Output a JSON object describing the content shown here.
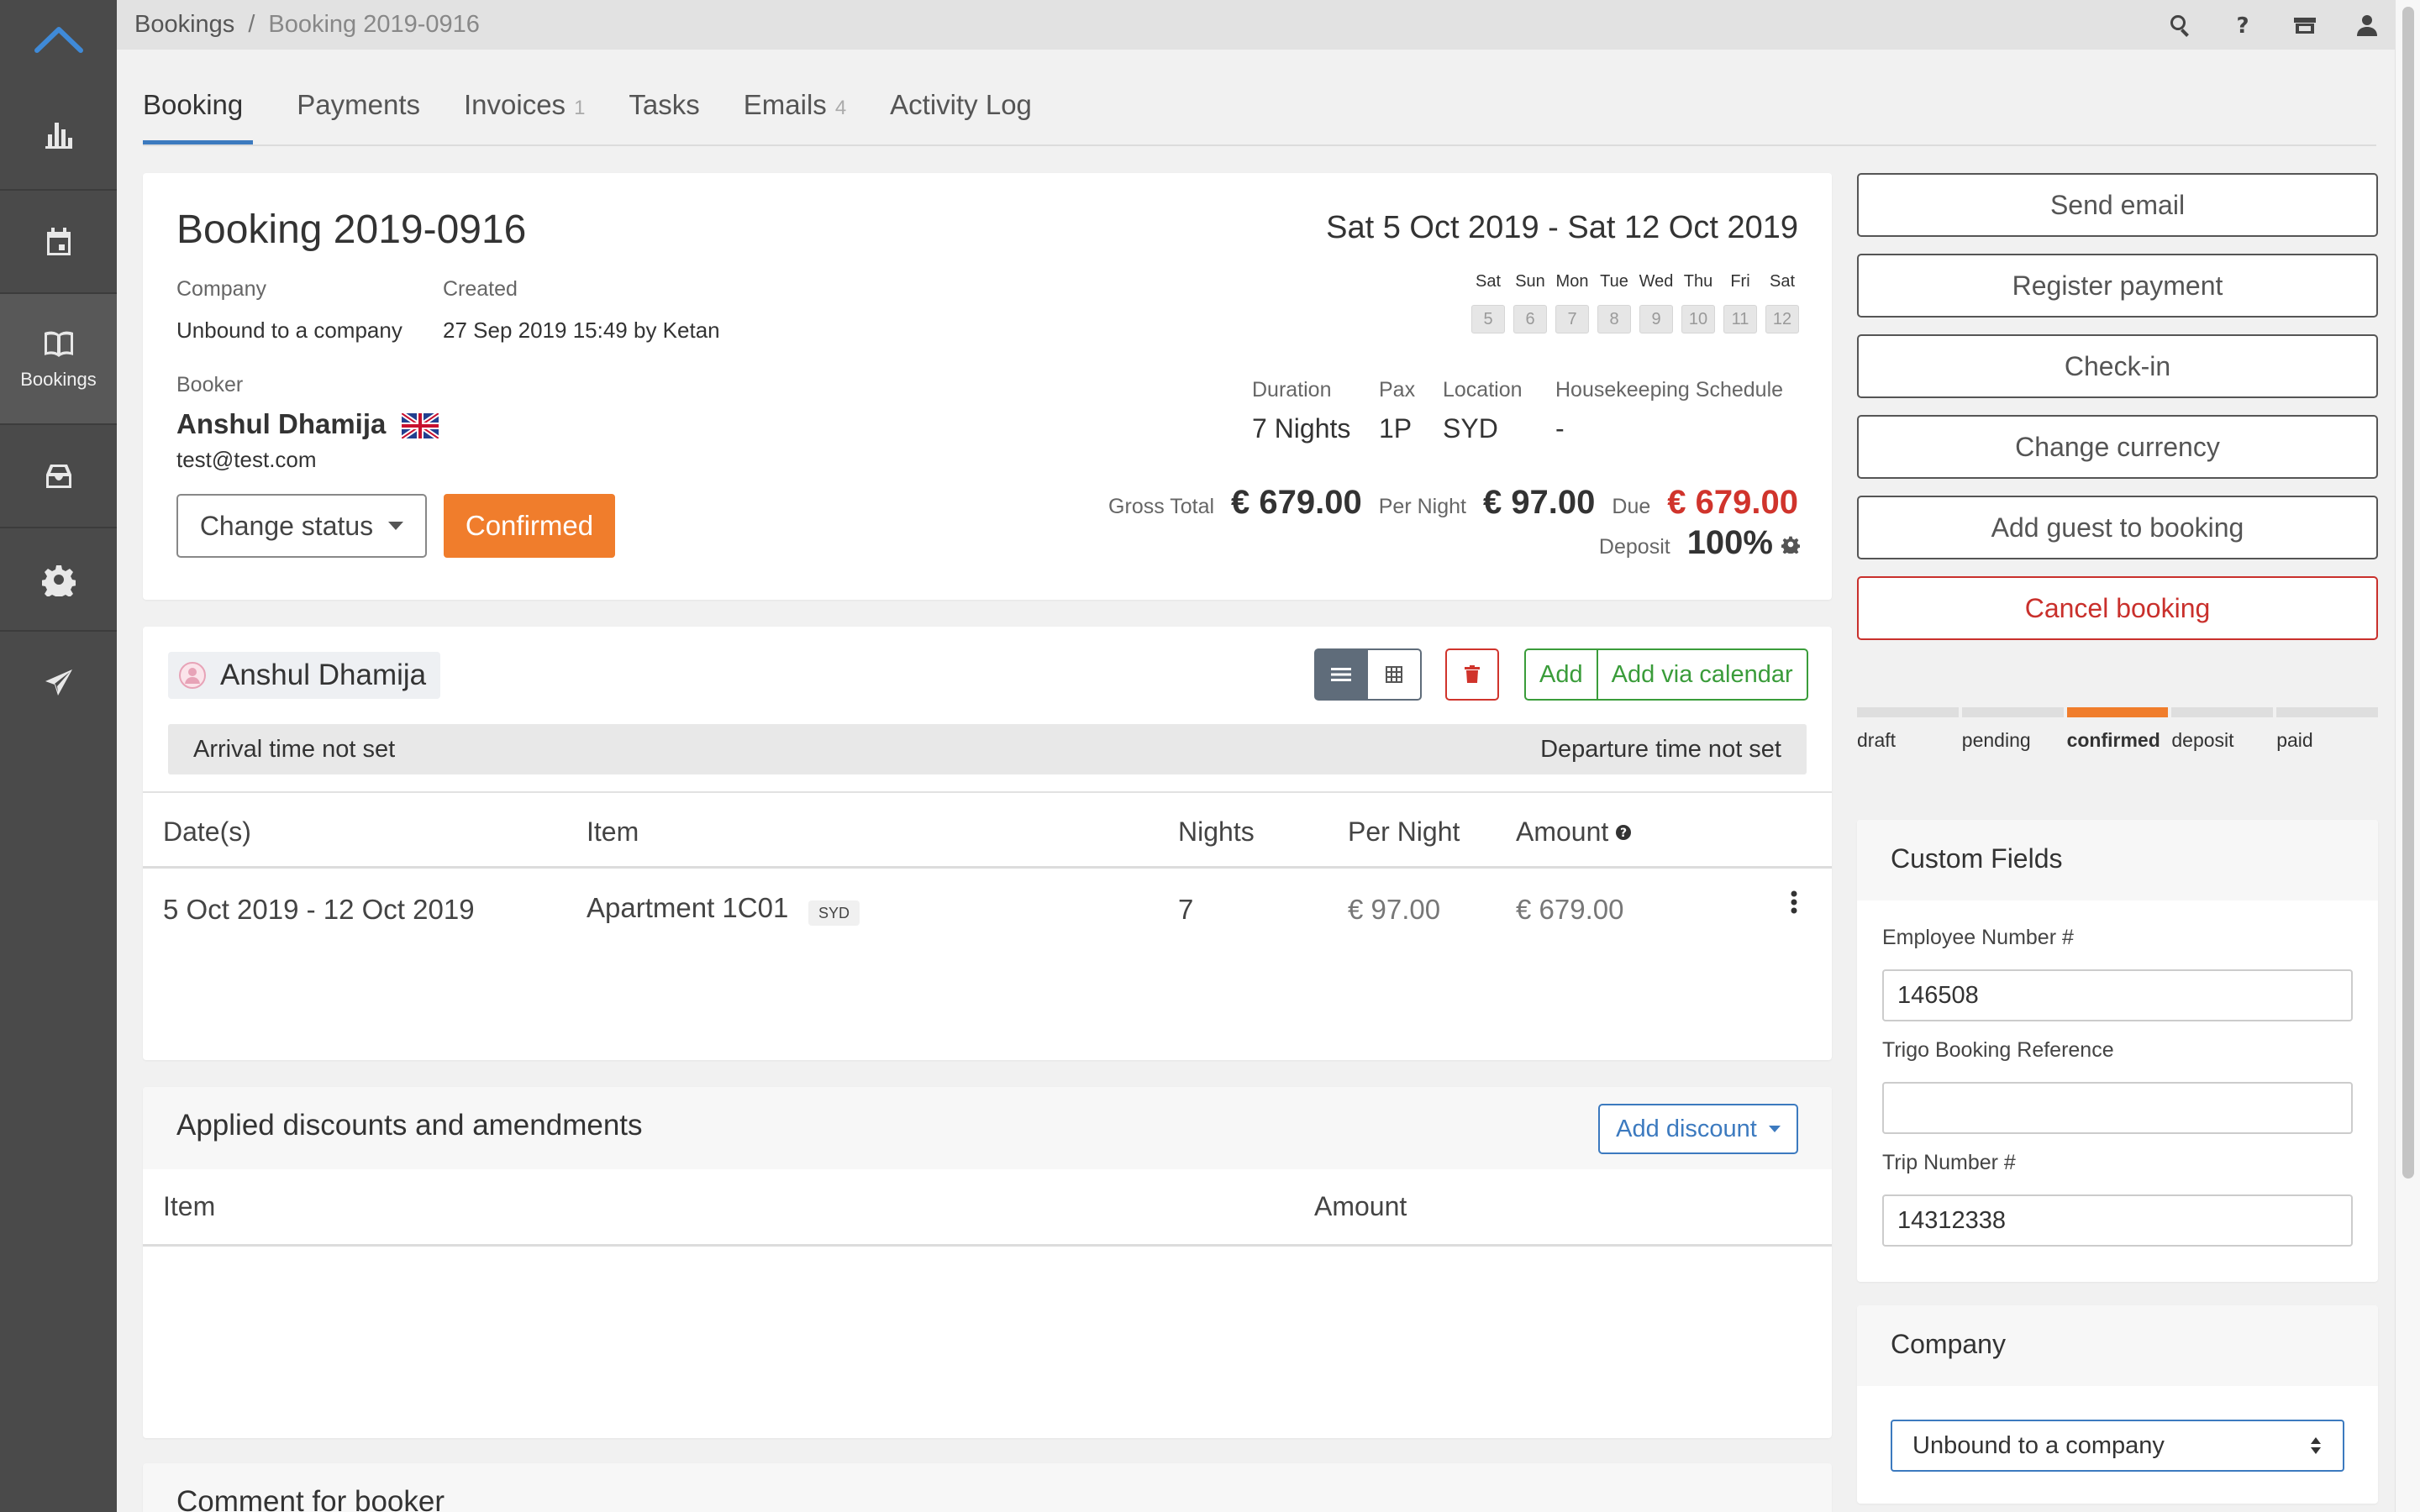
{
  "sidebar": {
    "items": [
      {
        "icon": "chart-icon",
        "label": ""
      },
      {
        "icon": "calendar-icon",
        "label": ""
      },
      {
        "icon": "book-icon",
        "label": "Bookings"
      },
      {
        "icon": "inbox-icon",
        "label": ""
      },
      {
        "icon": "gear-icon",
        "label": ""
      },
      {
        "icon": "send-icon",
        "label": ""
      }
    ]
  },
  "breadcrumb": {
    "root": "Bookings",
    "separator": "/",
    "current": "Booking 2019-0916"
  },
  "tabs": [
    {
      "label": "Booking",
      "count": ""
    },
    {
      "label": "Payments",
      "count": ""
    },
    {
      "label": "Invoices",
      "count": "1"
    },
    {
      "label": "Tasks",
      "count": ""
    },
    {
      "label": "Emails",
      "count": "4"
    },
    {
      "label": "Activity Log",
      "count": ""
    }
  ],
  "booking": {
    "title": "Booking 2019-0916",
    "date_range": "Sat 5 Oct 2019 - Sat 12 Oct 2019",
    "company_label": "Company",
    "company_value": "Unbound to a company",
    "created_label": "Created",
    "created_value": "27 Sep 2019 15:49 by Ketan",
    "booker_label": "Booker",
    "booker_name": "Anshul Dhamija",
    "booker_email": "test@test.com",
    "change_status": "Change status",
    "status": "Confirmed",
    "days": [
      {
        "dow": "Sat",
        "day": "5"
      },
      {
        "dow": "Sun",
        "day": "6"
      },
      {
        "dow": "Mon",
        "day": "7"
      },
      {
        "dow": "Tue",
        "day": "8"
      },
      {
        "dow": "Wed",
        "day": "9"
      },
      {
        "dow": "Thu",
        "day": "10"
      },
      {
        "dow": "Fri",
        "day": "11"
      },
      {
        "dow": "Sat",
        "day": "12"
      }
    ],
    "duration_label": "Duration",
    "duration_value": "7 Nights",
    "pax_label": "Pax",
    "pax_value": "1P",
    "location_label": "Location",
    "location_value": "SYD",
    "housekeeping_label": "Housekeeping Schedule",
    "housekeeping_value": "-",
    "gross_label": "Gross Total",
    "gross_value": "€ 679.00",
    "per_night_label": "Per Night",
    "per_night_value": "€ 97.00",
    "due_label": "Due",
    "due_value": "€ 679.00",
    "deposit_label": "Deposit",
    "deposit_value": "100%"
  },
  "guest": {
    "name": "Anshul Dhamija",
    "add": "Add",
    "add_calendar": "Add via calendar",
    "arrival": "Arrival time not set",
    "departure": "Departure time not set",
    "columns": [
      "Date(s)",
      "Item",
      "Nights",
      "Per Night",
      "Amount"
    ],
    "rows": [
      {
        "dates": "5 Oct 2019 - 12 Oct 2019",
        "item": "Apartment 1C01",
        "tag": "SYD",
        "nights": "7",
        "per_night": "€ 97.00",
        "amount": "€ 679.00"
      }
    ]
  },
  "discounts": {
    "title": "Applied discounts and amendments",
    "add_button": "Add discount",
    "columns": [
      "Item",
      "Amount"
    ]
  },
  "comment": {
    "title": "Comment for booker"
  },
  "actions": {
    "send_email": "Send email",
    "register_payment": "Register payment",
    "check_in": "Check-in",
    "change_currency": "Change currency",
    "add_guest": "Add guest to booking",
    "cancel": "Cancel booking"
  },
  "status_steps": [
    {
      "label": "draft",
      "active": false
    },
    {
      "label": "pending",
      "active": false
    },
    {
      "label": "confirmed",
      "active": true
    },
    {
      "label": "deposit",
      "active": false
    },
    {
      "label": "paid",
      "active": false
    }
  ],
  "custom_fields": {
    "title": "Custom Fields",
    "employee_label": "Employee Number #",
    "employee_value": "146508",
    "trigo_label": "Trigo Booking Reference",
    "trigo_value": "",
    "trip_label": "Trip Number #",
    "trip_value": "14312338"
  },
  "company_card": {
    "title": "Company",
    "selected": "Unbound to a company"
  },
  "colors": {
    "accent": "#3c7abf",
    "status": "#f07d2c",
    "danger": "#d0342c",
    "success": "#3a9c3a"
  }
}
